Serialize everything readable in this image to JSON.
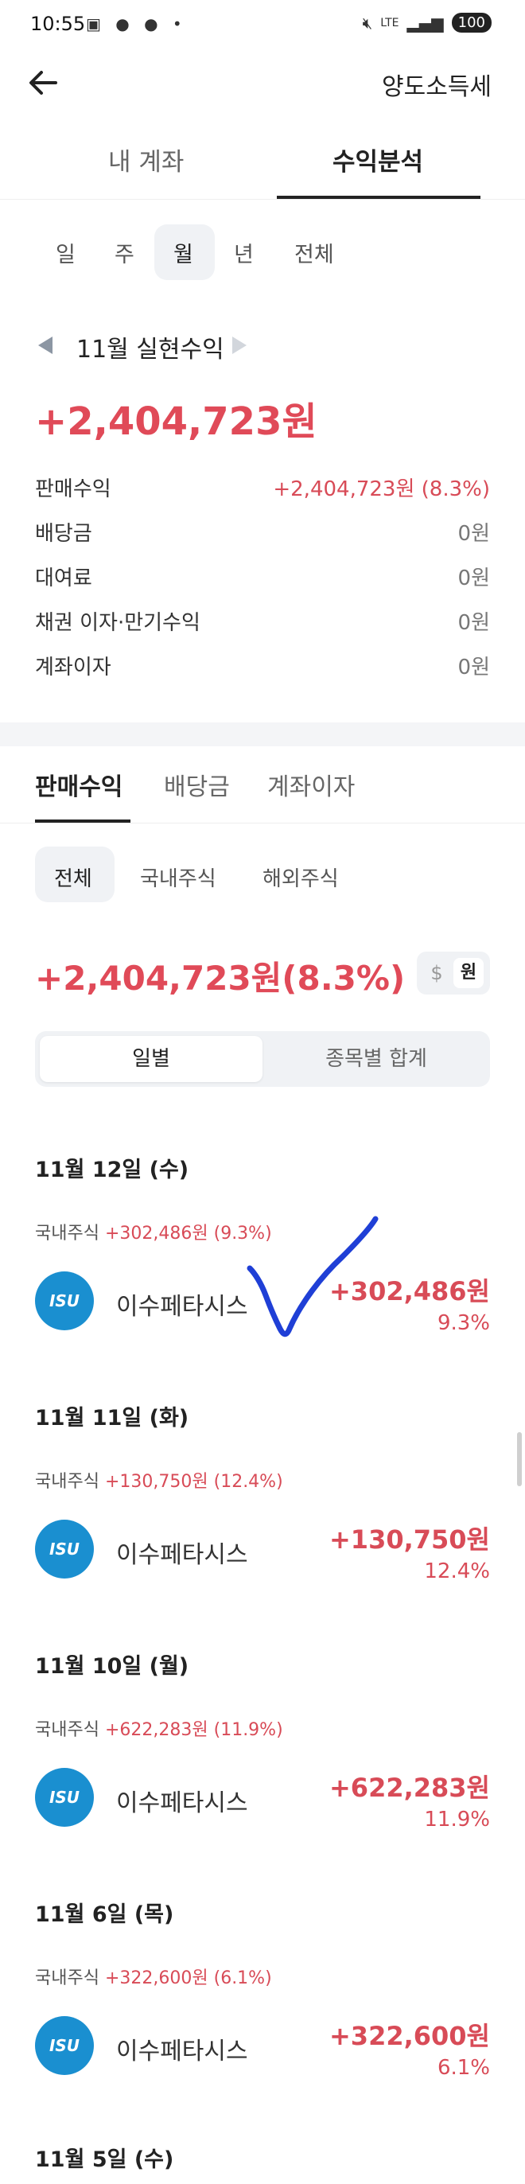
{
  "status_bar": {
    "time": "10:55",
    "battery": "100",
    "network": "LTE"
  },
  "header": {
    "title": "양도소득세"
  },
  "main_tabs": [
    {
      "label": "내 계좌"
    },
    {
      "label": "수익분석"
    }
  ],
  "period_tabs": [
    "일",
    "주",
    "월",
    "년",
    "전체"
  ],
  "period_selected": "월",
  "summary": {
    "month_label": "11월 실현수익",
    "total": "+2,404,723원",
    "rows": [
      {
        "label": "판매수익",
        "value": "+2,404,723원 (8.3%)"
      },
      {
        "label": "배당금",
        "value": "0원"
      },
      {
        "label": "대여료",
        "value": "0원"
      },
      {
        "label": "채권 이자·만기수익",
        "value": "0원"
      },
      {
        "label": "계좌이자",
        "value": "0원"
      }
    ]
  },
  "sub_tabs": [
    "판매수익",
    "배당금",
    "계좌이자"
  ],
  "market_filters": [
    "전체",
    "국내주식",
    "해외주식"
  ],
  "sales_total": "+2,404,723원(8.3%)",
  "currency": {
    "usd": "$",
    "krw": "원"
  },
  "segment": {
    "daily": "일별",
    "by_stock": "종목별 합계"
  },
  "days": [
    {
      "date": "11월 12일 (수)",
      "market": "국내주식",
      "subtotal": "+302,486원 (9.3%)",
      "stock": {
        "logo": "ISU",
        "name": "이수페타시스",
        "amount": "+302,486원",
        "pct": "9.3%"
      }
    },
    {
      "date": "11월 11일 (화)",
      "market": "국내주식",
      "subtotal": "+130,750원 (12.4%)",
      "stock": {
        "logo": "ISU",
        "name": "이수페타시스",
        "amount": "+130,750원",
        "pct": "12.4%"
      }
    },
    {
      "date": "11월 10일 (월)",
      "market": "국내주식",
      "subtotal": "+622,283원 (11.9%)",
      "stock": {
        "logo": "ISU",
        "name": "이수페타시스",
        "amount": "+622,283원",
        "pct": "11.9%"
      }
    },
    {
      "date": "11월 6일 (목)",
      "market": "국내주식",
      "subtotal": "+322,600원 (6.1%)",
      "stock": {
        "logo": "ISU",
        "name": "이수페타시스",
        "amount": "+322,600원",
        "pct": "6.1%"
      }
    },
    {
      "date": "11월 5일 (수)"
    }
  ],
  "colors": {
    "profit_red": "#e04a58",
    "logo_blue": "#1a8fd0",
    "check_blue": "#1f3fd6"
  }
}
